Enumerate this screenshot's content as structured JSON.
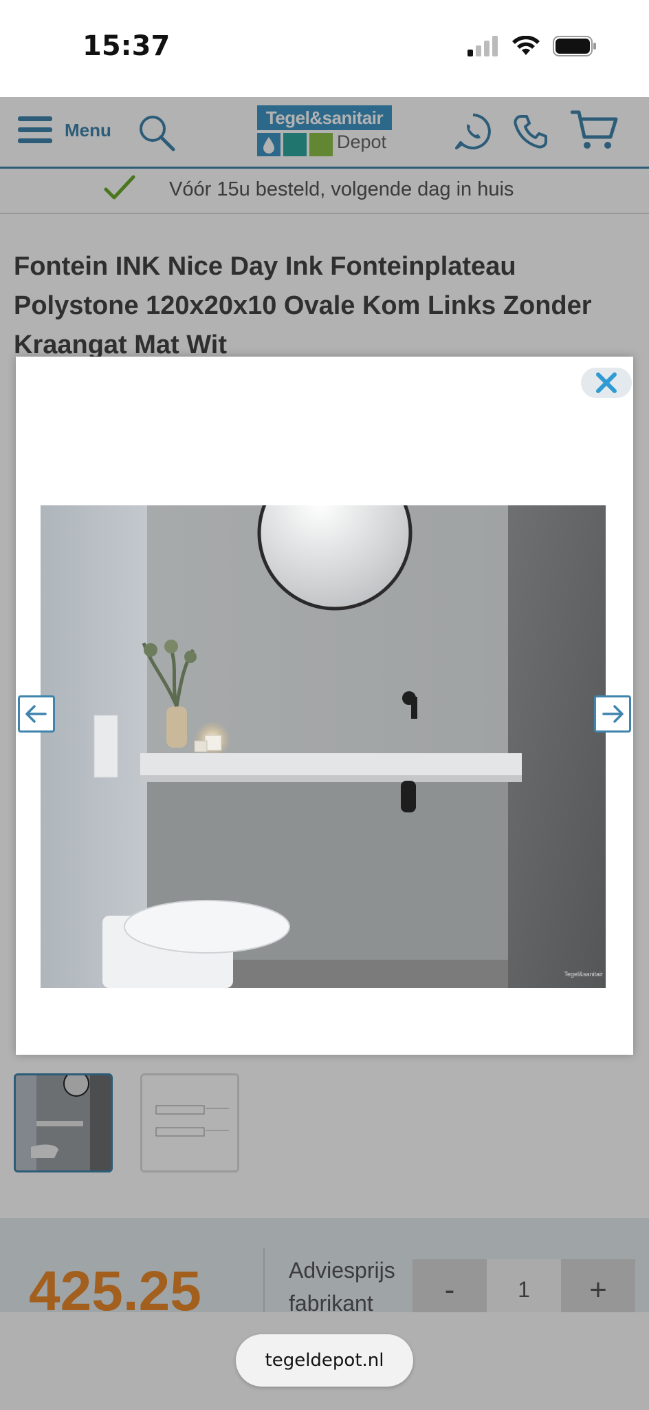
{
  "status_bar": {
    "time": "15:37"
  },
  "header": {
    "menu_label": "Menu",
    "logo": {
      "top": "Tegel&sanitair",
      "bottom": "Depot"
    }
  },
  "usp": {
    "text": "Vóór 15u besteld, volgende dag in huis"
  },
  "product": {
    "title": "Fontein INK Nice Day Ink Fonteinplateau Polystone 120x20x10 Ovale Kom Links Zonder Kraangat Mat Wit"
  },
  "price_bar": {
    "price": "425.25",
    "advies_line1": "Adviesprijs",
    "advies_line2": "fabrikant",
    "qty_minus": "-",
    "qty_value": "1",
    "qty_plus": "+"
  },
  "lightbox": {
    "close_icon": "close-icon",
    "prev_icon": "arrow-left-icon",
    "next_icon": "arrow-right-icon",
    "watermark": "Tegel&sanitair"
  },
  "browser": {
    "url": "tegeldepot.nl"
  },
  "colors": {
    "brand_blue": "#3f84ad",
    "logo_blue": "#3f95c6",
    "price_orange": "#e8892a",
    "check_green": "#6aaa2a"
  }
}
